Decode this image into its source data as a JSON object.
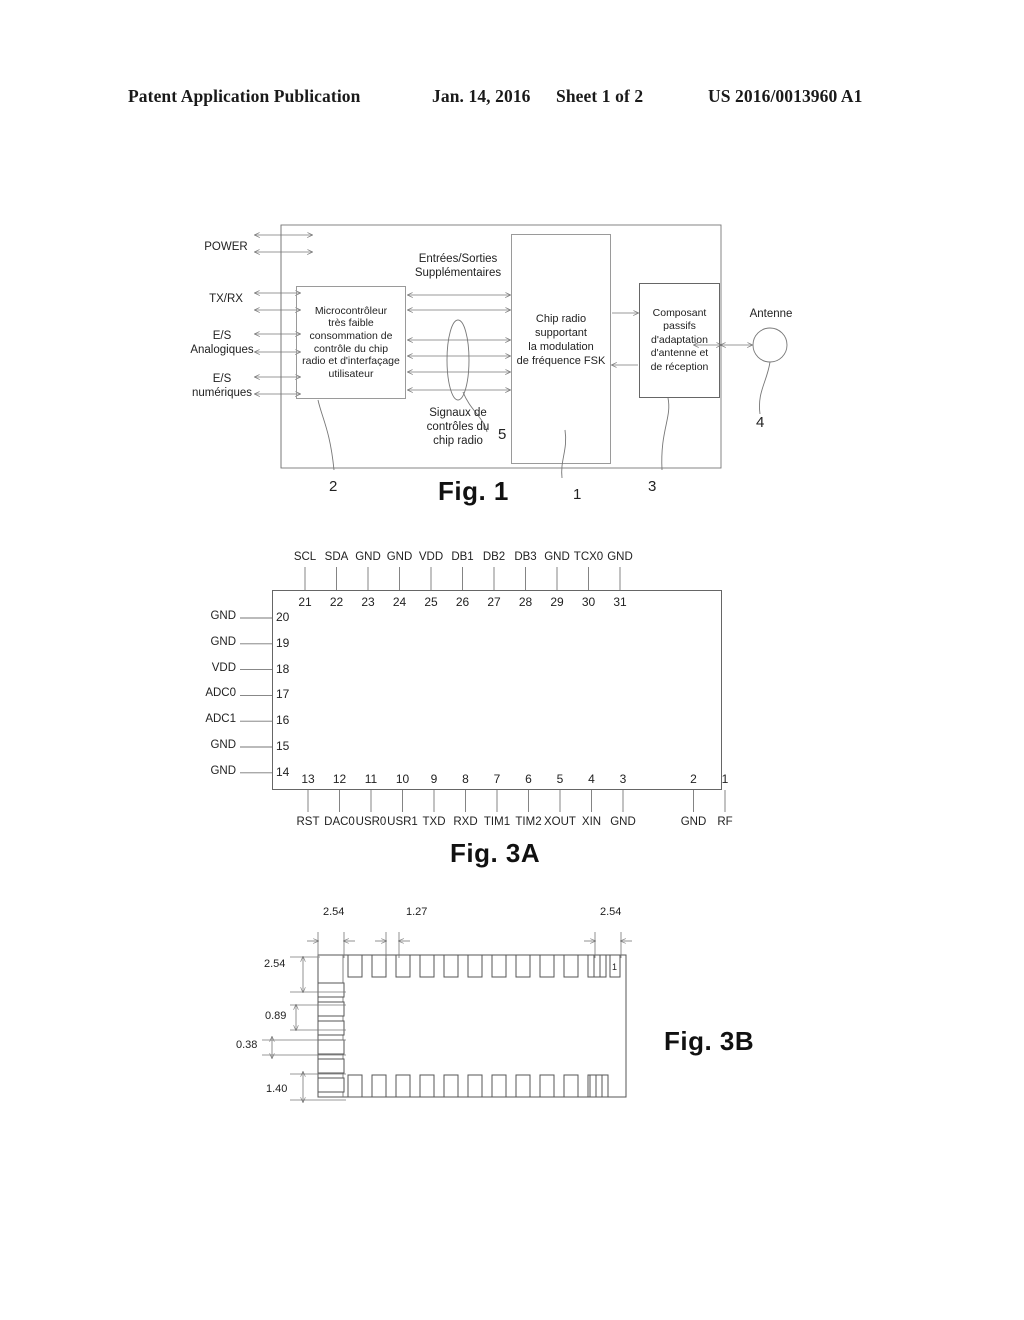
{
  "header": {
    "publication": "Patent Application Publication",
    "date": "Jan. 14, 2016",
    "sheet": "Sheet 1 of 2",
    "number": "US 2016/0013960 A1"
  },
  "figure1": {
    "caption": "Fig. 1",
    "left_ports": [
      {
        "label": "POWER"
      },
      {
        "label": "TX/RX"
      },
      {
        "label": "E/S\nAnalogiques"
      },
      {
        "label": "E/S\nnumériques"
      }
    ],
    "left_port_labels": {
      "power": "POWER",
      "txrx": "TX/RX",
      "analog_1": "E/S",
      "analog_2": "Analogiques",
      "digital_1": "E/S",
      "digital_2": "numériques"
    },
    "blocks": {
      "microcontroller": "Microcontrôleur très faible consommation de contrôle du chip radio et d'interfaçage utilisateur",
      "microcontroller_lines": [
        "Microcontrôleur",
        "très faible",
        "consommation de",
        "contrôle du chip",
        "radio et d'interfaçage",
        "utilisateur"
      ],
      "radio_chip_lines": [
        "Chip radio",
        "supportant",
        "la modulation",
        "de fréquence FSK"
      ],
      "passive_lines": [
        "Composant",
        "passifs",
        "d'adaptation",
        "d'antenne et",
        "de réception"
      ]
    },
    "annotations": {
      "extra_io_1": "Entrées/Sorties",
      "extra_io_2": "Supplémentaires",
      "control_signals_1": "Signaux de",
      "control_signals_2": "contrôles du",
      "control_signals_3": "chip radio",
      "antenna": "Antenne"
    },
    "reference_numbers": {
      "microcontroller": "2",
      "radio_chip": "1",
      "passive": "3",
      "antenna": "4",
      "control_signals": "5"
    }
  },
  "figure3a": {
    "caption": "Fig. 3A",
    "top_pins": [
      {
        "num": "21",
        "name": "SCL"
      },
      {
        "num": "22",
        "name": "SDA"
      },
      {
        "num": "23",
        "name": "GND"
      },
      {
        "num": "24",
        "name": "GND"
      },
      {
        "num": "25",
        "name": "VDD"
      },
      {
        "num": "26",
        "name": "DB1"
      },
      {
        "num": "27",
        "name": "DB2"
      },
      {
        "num": "28",
        "name": "DB3"
      },
      {
        "num": "29",
        "name": "GND"
      },
      {
        "num": "30",
        "name": "TCX0"
      },
      {
        "num": "31",
        "name": "GND"
      }
    ],
    "left_pins": [
      {
        "num": "20",
        "name": "GND"
      },
      {
        "num": "19",
        "name": "GND"
      },
      {
        "num": "18",
        "name": "VDD"
      },
      {
        "num": "17",
        "name": "ADC0"
      },
      {
        "num": "16",
        "name": "ADC1"
      },
      {
        "num": "15",
        "name": "GND"
      },
      {
        "num": "14",
        "name": "GND"
      }
    ],
    "bottom_pins": [
      {
        "num": "13",
        "name": "RST"
      },
      {
        "num": "12",
        "name": "DAC0"
      },
      {
        "num": "11",
        "name": "USR0"
      },
      {
        "num": "10",
        "name": "USR1"
      },
      {
        "num": "9",
        "name": "TXD"
      },
      {
        "num": "8",
        "name": "RXD"
      },
      {
        "num": "7",
        "name": "TIM1"
      },
      {
        "num": "6",
        "name": "TIM2"
      },
      {
        "num": "5",
        "name": "XOUT"
      },
      {
        "num": "4",
        "name": "XIN"
      },
      {
        "num": "3",
        "name": "GND"
      },
      {
        "num": "2",
        "name": "GND"
      },
      {
        "num": "1",
        "name": "RF"
      }
    ]
  },
  "figure3b": {
    "caption": "Fig. 3B",
    "dimensions": {
      "top_left_pitch": "2.54",
      "top_mid_pitch": "1.27",
      "top_right_pitch": "2.54",
      "left_offset": "2.54",
      "pad_pitch": "0.89",
      "pad_width": "0.38",
      "bottom_offset": "1.40"
    },
    "pin_marker": "1"
  }
}
